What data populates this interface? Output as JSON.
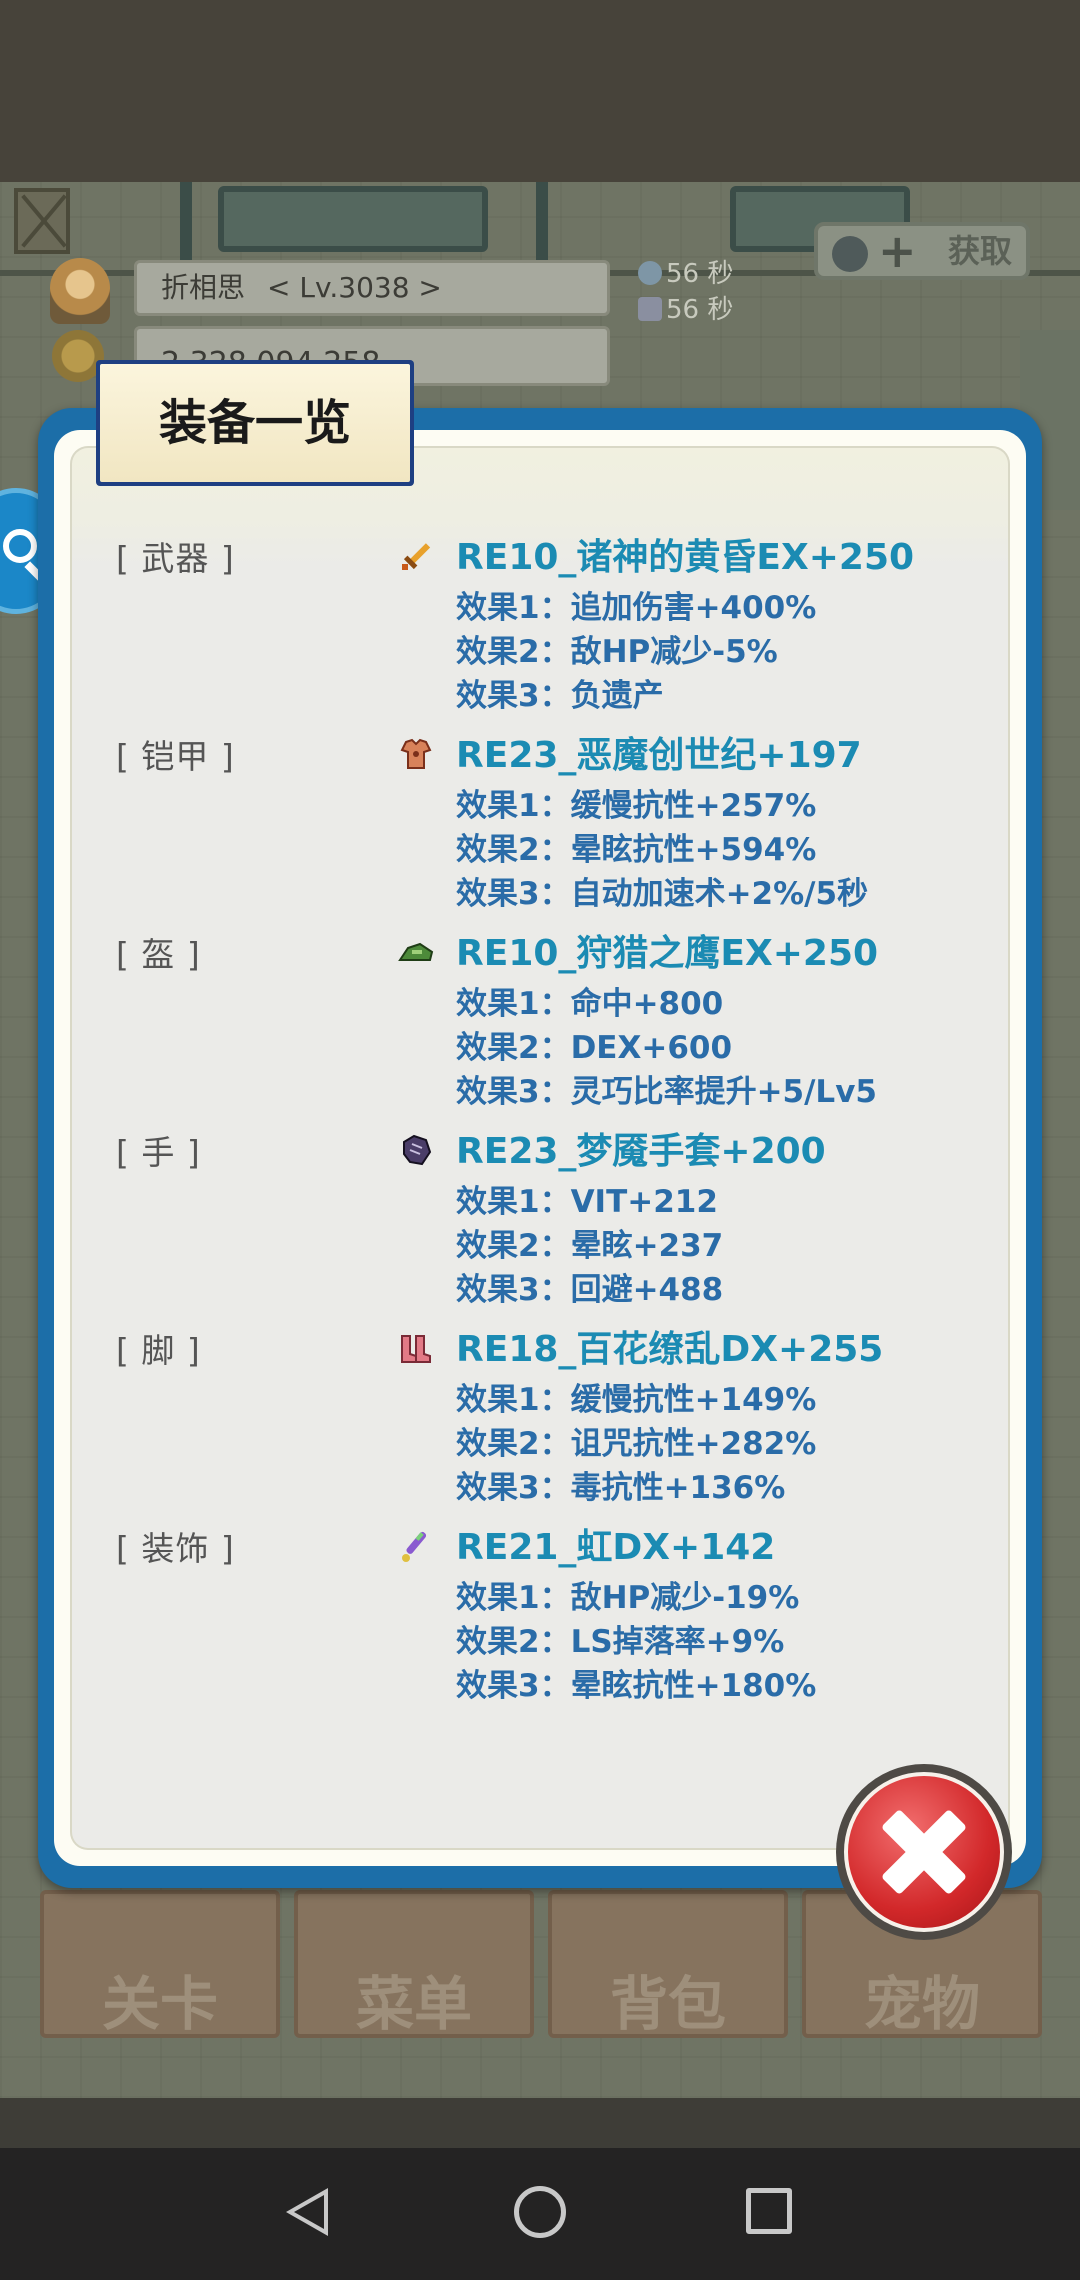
{
  "player": {
    "name": "折相思",
    "level": "< Lv.3038 >",
    "gold": "2,328,094,258",
    "timer1": "56 秒",
    "timer2": "56 秒",
    "get_label": "获取"
  },
  "modal": {
    "title": "装备一览"
  },
  "equipment": [
    {
      "slot": "[ 武器 ]",
      "icon": "sword-icon",
      "name": "RE10_诸神的黄昏EX+250",
      "effects": [
        "效果1：追加伤害+400%",
        "效果2：敌HP减少-5%",
        "效果3：负遗产"
      ]
    },
    {
      "slot": "[ 铠甲 ]",
      "icon": "armor-icon",
      "name": "RE23_恶魔创世纪+197",
      "effects": [
        "效果1：缓慢抗性+257%",
        "效果2：晕眩抗性+594%",
        "效果3：自动加速术+2%/5秒"
      ]
    },
    {
      "slot": "[ 盔 ]",
      "icon": "helmet-icon",
      "name": "RE10_狩猎之鹰EX+250",
      "effects": [
        "效果1：命中+800",
        "效果2：DEX+600",
        "效果3：灵巧比率提升+5/Lv5"
      ]
    },
    {
      "slot": "[ 手 ]",
      "icon": "glove-icon",
      "name": "RE23_梦魇手套+200",
      "effects": [
        "效果1：VIT+212",
        "效果2：晕眩+237",
        "效果3：回避+488"
      ]
    },
    {
      "slot": "[ 脚 ]",
      "icon": "boots-icon",
      "name": "RE18_百花缭乱DX+255",
      "effects": [
        "效果1：缓慢抗性+149%",
        "效果2：诅咒抗性+282%",
        "效果3：毒抗性+136%"
      ]
    },
    {
      "slot": "[ 装饰 ]",
      "icon": "accessory-icon",
      "name": "RE21_虹DX+142",
      "effects": [
        "效果1：敌HP减少-19%",
        "效果2：LS掉落率+9%",
        "效果3：晕眩抗性+180%"
      ]
    }
  ],
  "tabs": [
    "关卡",
    "菜单",
    "背包",
    "宠物"
  ],
  "colors": {
    "modal_border": "#1c6ea8",
    "item_name": "#1b8bb3",
    "effect_text": "#2a6ca8",
    "close_button": "#d2282a"
  }
}
